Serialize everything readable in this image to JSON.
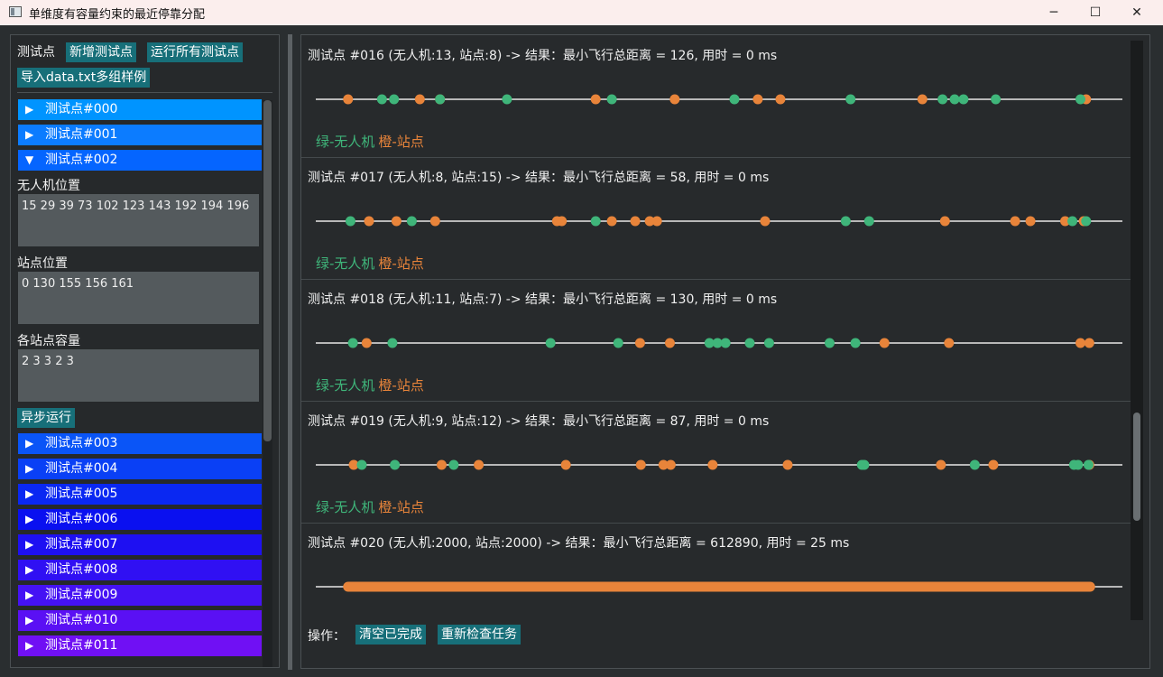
{
  "window": {
    "title": "单维度有容量约束的最近停靠分配",
    "controls": [
      "─",
      "☐",
      "✕"
    ]
  },
  "left_panel": {
    "toolbar_label": "测试点",
    "add_button": "新增测试点",
    "run_all_button": "运行所有测试点",
    "import_button": "导入data.txt多组样例",
    "items_top": [
      {
        "label": "测试点#000",
        "state": "collapsed",
        "color": "#0094ff"
      },
      {
        "label": "测试点#001",
        "state": "collapsed",
        "color": "#0c7cff"
      },
      {
        "label": "测试点#002",
        "state": "expanded",
        "color": "#0565ff"
      }
    ],
    "detail": {
      "drones_label": "无人机位置",
      "drones_value": "15 29 39 73 102 123 143 192 194 196",
      "stations_label": "站点位置",
      "stations_value": "0 130 155 156 161",
      "capacity_label": "各站点容量",
      "capacity_value": "2 3 3 2 3",
      "run_async_button": "异步运行"
    },
    "items_bottom": [
      {
        "label": "测试点#003",
        "state": "collapsed",
        "color": "#0a55f7"
      },
      {
        "label": "测试点#004",
        "state": "collapsed",
        "color": "#0a40f5"
      },
      {
        "label": "测试点#005",
        "state": "collapsed",
        "color": "#0a28f2"
      },
      {
        "label": "测试点#006",
        "state": "collapsed",
        "color": "#0a10f0"
      },
      {
        "label": "测试点#007",
        "state": "collapsed",
        "color": "#1e10f2"
      },
      {
        "label": "测试点#008",
        "state": "collapsed",
        "color": "#3010f3"
      },
      {
        "label": "测试点#009",
        "state": "collapsed",
        "color": "#4512f4"
      },
      {
        "label": "测试点#010",
        "state": "collapsed",
        "color": "#5a10f4"
      },
      {
        "label": "测试点#011",
        "state": "collapsed",
        "color": "#7010f4"
      }
    ]
  },
  "right_panel": {
    "colors": {
      "drone": "#3fb57a",
      "station": "#e8843a",
      "axis": "#b8b8b8"
    },
    "legend": {
      "drone": "绿-无人机",
      "station": "橙-站点"
    },
    "cases": [
      {
        "header": "测试点 #016 (无人机:13, 站点:8) -> 结果：最小飞行总距离 = 126, 用时 = 0 ms",
        "stations": [
          0.04,
          0.129,
          0.154,
          0.347,
          0.445,
          0.548,
          0.576,
          0.752,
          0.955
        ],
        "drones": [
          0.082,
          0.097,
          0.154,
          0.237,
          0.367,
          0.519,
          0.663,
          0.777,
          0.792,
          0.803,
          0.843,
          0.948
        ]
      },
      {
        "header": "测试点 #017 (无人机:8, 站点:15) -> 结果：最小飞行总距离 = 58, 用时 = 0 ms",
        "stations": [
          0.066,
          0.1,
          0.148,
          0.299,
          0.305,
          0.367,
          0.396,
          0.414,
          0.423,
          0.557,
          0.78,
          0.867,
          0.886,
          0.929,
          0.952
        ],
        "drones": [
          0.043,
          0.119,
          0.347,
          0.657,
          0.686,
          0.938,
          0.955
        ]
      },
      {
        "header": "测试点 #018 (无人机:11, 站点:7) -> 结果：最小飞行总距离 = 130, 用时 = 0 ms",
        "stations": [
          0.063,
          0.402,
          0.439,
          0.705,
          0.785,
          0.948,
          0.959
        ],
        "drones": [
          0.046,
          0.095,
          0.291,
          0.375,
          0.488,
          0.498,
          0.508,
          0.538,
          0.562,
          0.637,
          0.669
        ]
      },
      {
        "header": "测试点 #019 (无人机:9, 站点:12) -> 结果：最小飞行总距离 = 87, 用时 = 0 ms",
        "stations": [
          0.047,
          0.156,
          0.202,
          0.31,
          0.403,
          0.431,
          0.44,
          0.492,
          0.585,
          0.775,
          0.84,
          0.959
        ],
        "drones": [
          0.057,
          0.098,
          0.171,
          0.677,
          0.68,
          0.817,
          0.94,
          0.945,
          0.958
        ]
      },
      {
        "header": "测试点 #020 (无人机:2000, 站点:2000) -> 结果：最小飞行总距离 = 612890, 用时 = 25 ms",
        "stations": [],
        "drones": [],
        "dense_range": [
          0.04,
          0.96
        ]
      }
    ],
    "ops_label": "操作：",
    "clear_button": "清空已完成",
    "recheck_button": "重新检查任务"
  }
}
